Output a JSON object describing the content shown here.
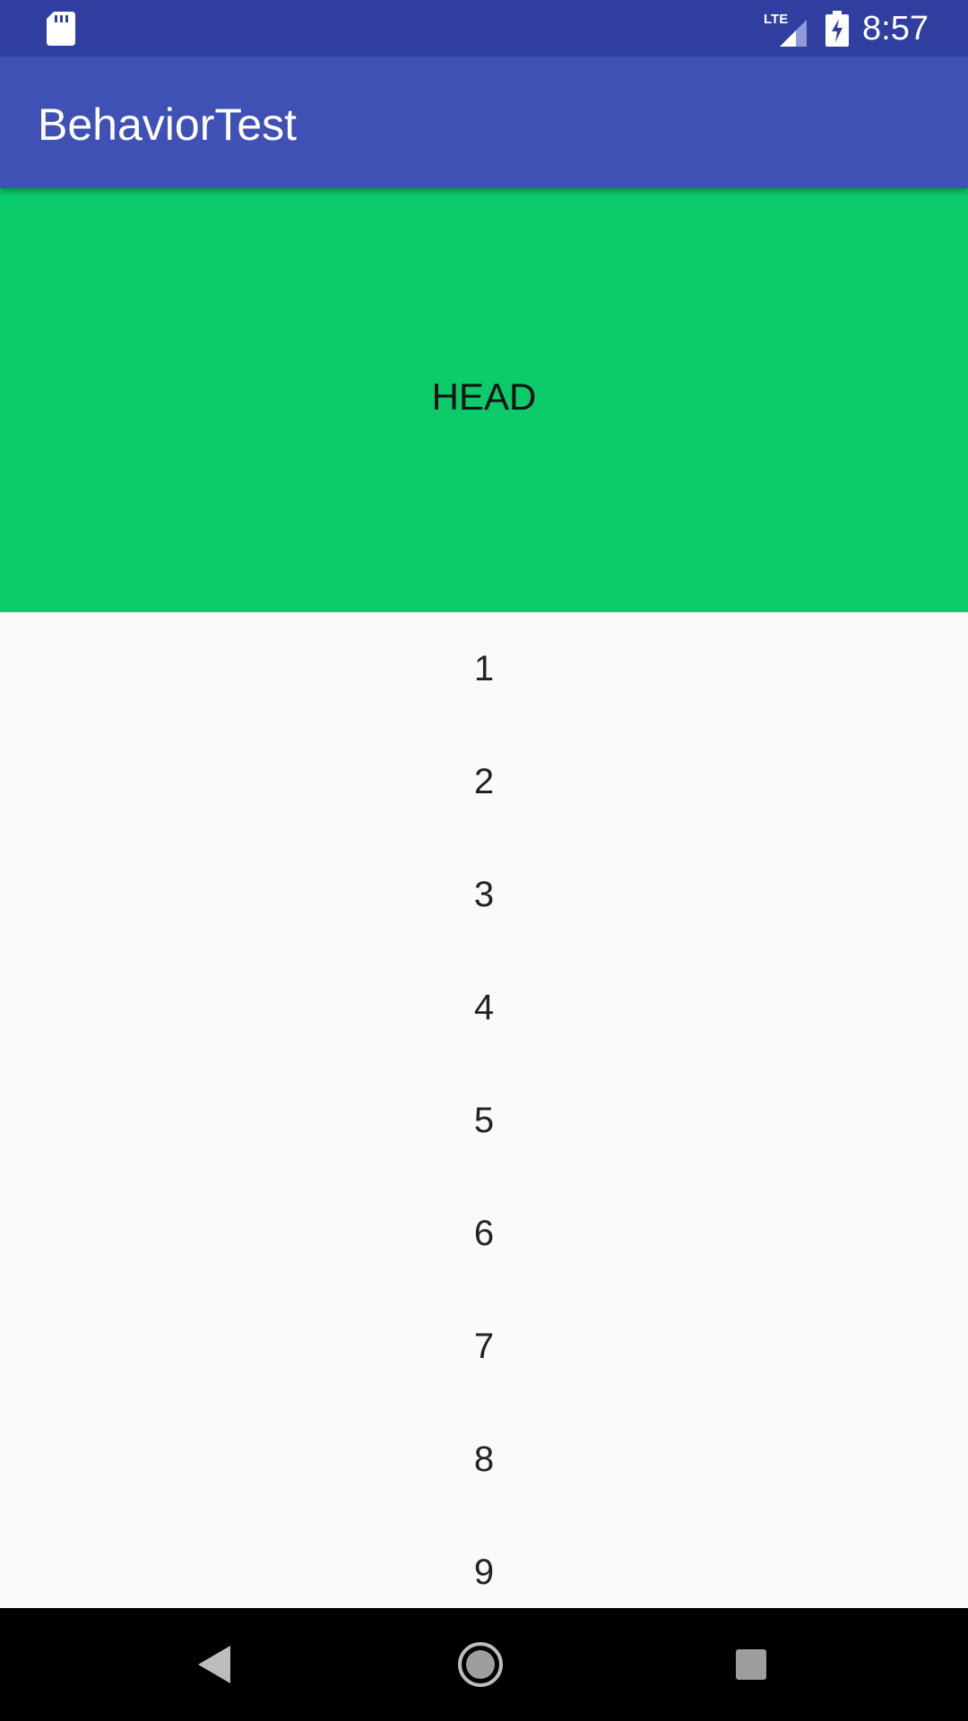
{
  "status_bar": {
    "time": "8:57",
    "network_label": "LTE",
    "sd_card_icon": "sd-card-icon",
    "signal_icon": "cell-signal-icon",
    "battery_icon": "battery-charging-icon"
  },
  "app_bar": {
    "title": "BehaviorTest"
  },
  "head": {
    "label": "HEAD",
    "color": "#0bcb6b"
  },
  "list": {
    "items": [
      "1",
      "2",
      "3",
      "4",
      "5",
      "6",
      "7",
      "8",
      "9"
    ]
  },
  "nav_bar": {
    "back_icon": "back-triangle-icon",
    "home_icon": "home-circle-icon",
    "recents_icon": "recents-square-icon"
  },
  "colors": {
    "status_bar": "#303f9f",
    "app_bar": "#3f51b5",
    "list_background": "#fafafa",
    "nav_bar": "#000000"
  }
}
